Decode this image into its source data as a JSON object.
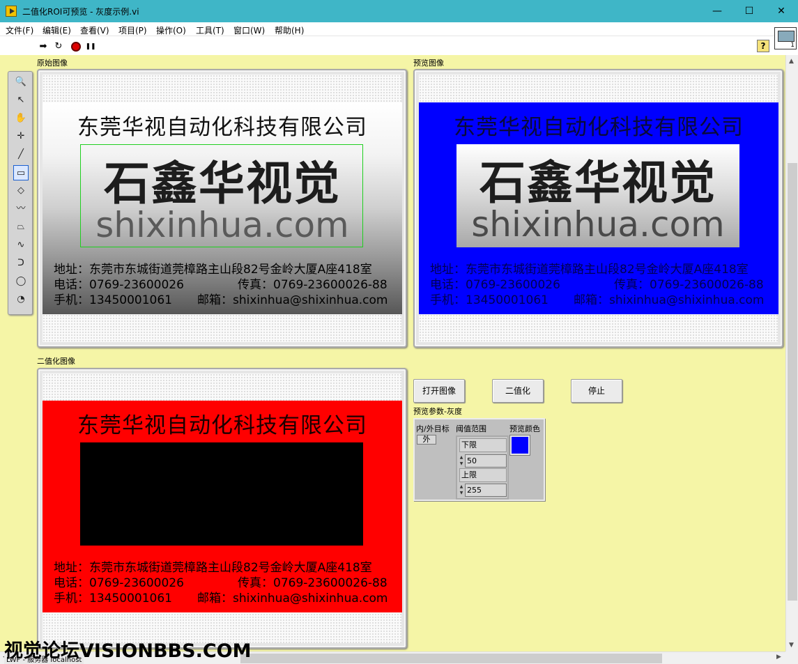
{
  "window": {
    "title": "二值化ROI可预览 - 灰度示例.vi",
    "min_glyph": "—",
    "max_glyph": "☐",
    "close_glyph": "✕"
  },
  "menu": [
    "文件(F)",
    "编辑(E)",
    "查看(V)",
    "项目(P)",
    "操作(O)",
    "工具(T)",
    "窗口(W)",
    "帮助(H)"
  ],
  "toolbar": {
    "run_glyph": "➡",
    "run_continuous_glyph": "↻",
    "pause_glyph": "❚❚",
    "help_glyph": "?",
    "vi_icon_number": "1"
  },
  "labels": {
    "original": "原始图像",
    "preview": "预览图像",
    "binary": "二值化图像"
  },
  "card": {
    "company": "东莞华视自动化科技有限公司",
    "brand": "石鑫华视觉",
    "domain": "shixinhua.com",
    "address": "地址：东莞市东城街道莞樟路主山段82号金岭大厦A座418室",
    "phone": "电话：0769-23600026",
    "fax": "传真：0769-23600026-88",
    "mobile": "手机：13450001061",
    "email": "邮箱：shixinhua@shixinhua.com"
  },
  "buttons": {
    "open": "打开图像",
    "binarize": "二值化",
    "stop": "停止"
  },
  "params": {
    "title": "预览参数-灰度",
    "in_out_label": "内/外目标",
    "in_out_value": "外",
    "threshold_label": "阈值范围",
    "lower_label": "下限",
    "lower_value": "50",
    "upper_label": "上限",
    "upper_value": "255",
    "color_label": "预览颜色",
    "color_value": "#0000ff"
  },
  "palette_tools": [
    "zoom-icon",
    "pointer-icon",
    "hand-icon",
    "crosshair-icon",
    "line-icon",
    "rectangle-icon",
    "rotated-rectangle-icon",
    "polyline-icon",
    "polygon-icon",
    "freehand-line-icon",
    "freehand-region-icon",
    "oval-icon",
    "annulus-icon"
  ],
  "palette_glyphs": [
    "🔍",
    "↖",
    "✋",
    "✛",
    "╱",
    "▭",
    "◇",
    "〰",
    "⏢",
    "∿",
    "ᑐ",
    "◯",
    "◔"
  ],
  "overlay": {
    "watermark": "视觉论坛VISIONBBS.COM",
    "status": "LWF - 服务器 localhost"
  }
}
